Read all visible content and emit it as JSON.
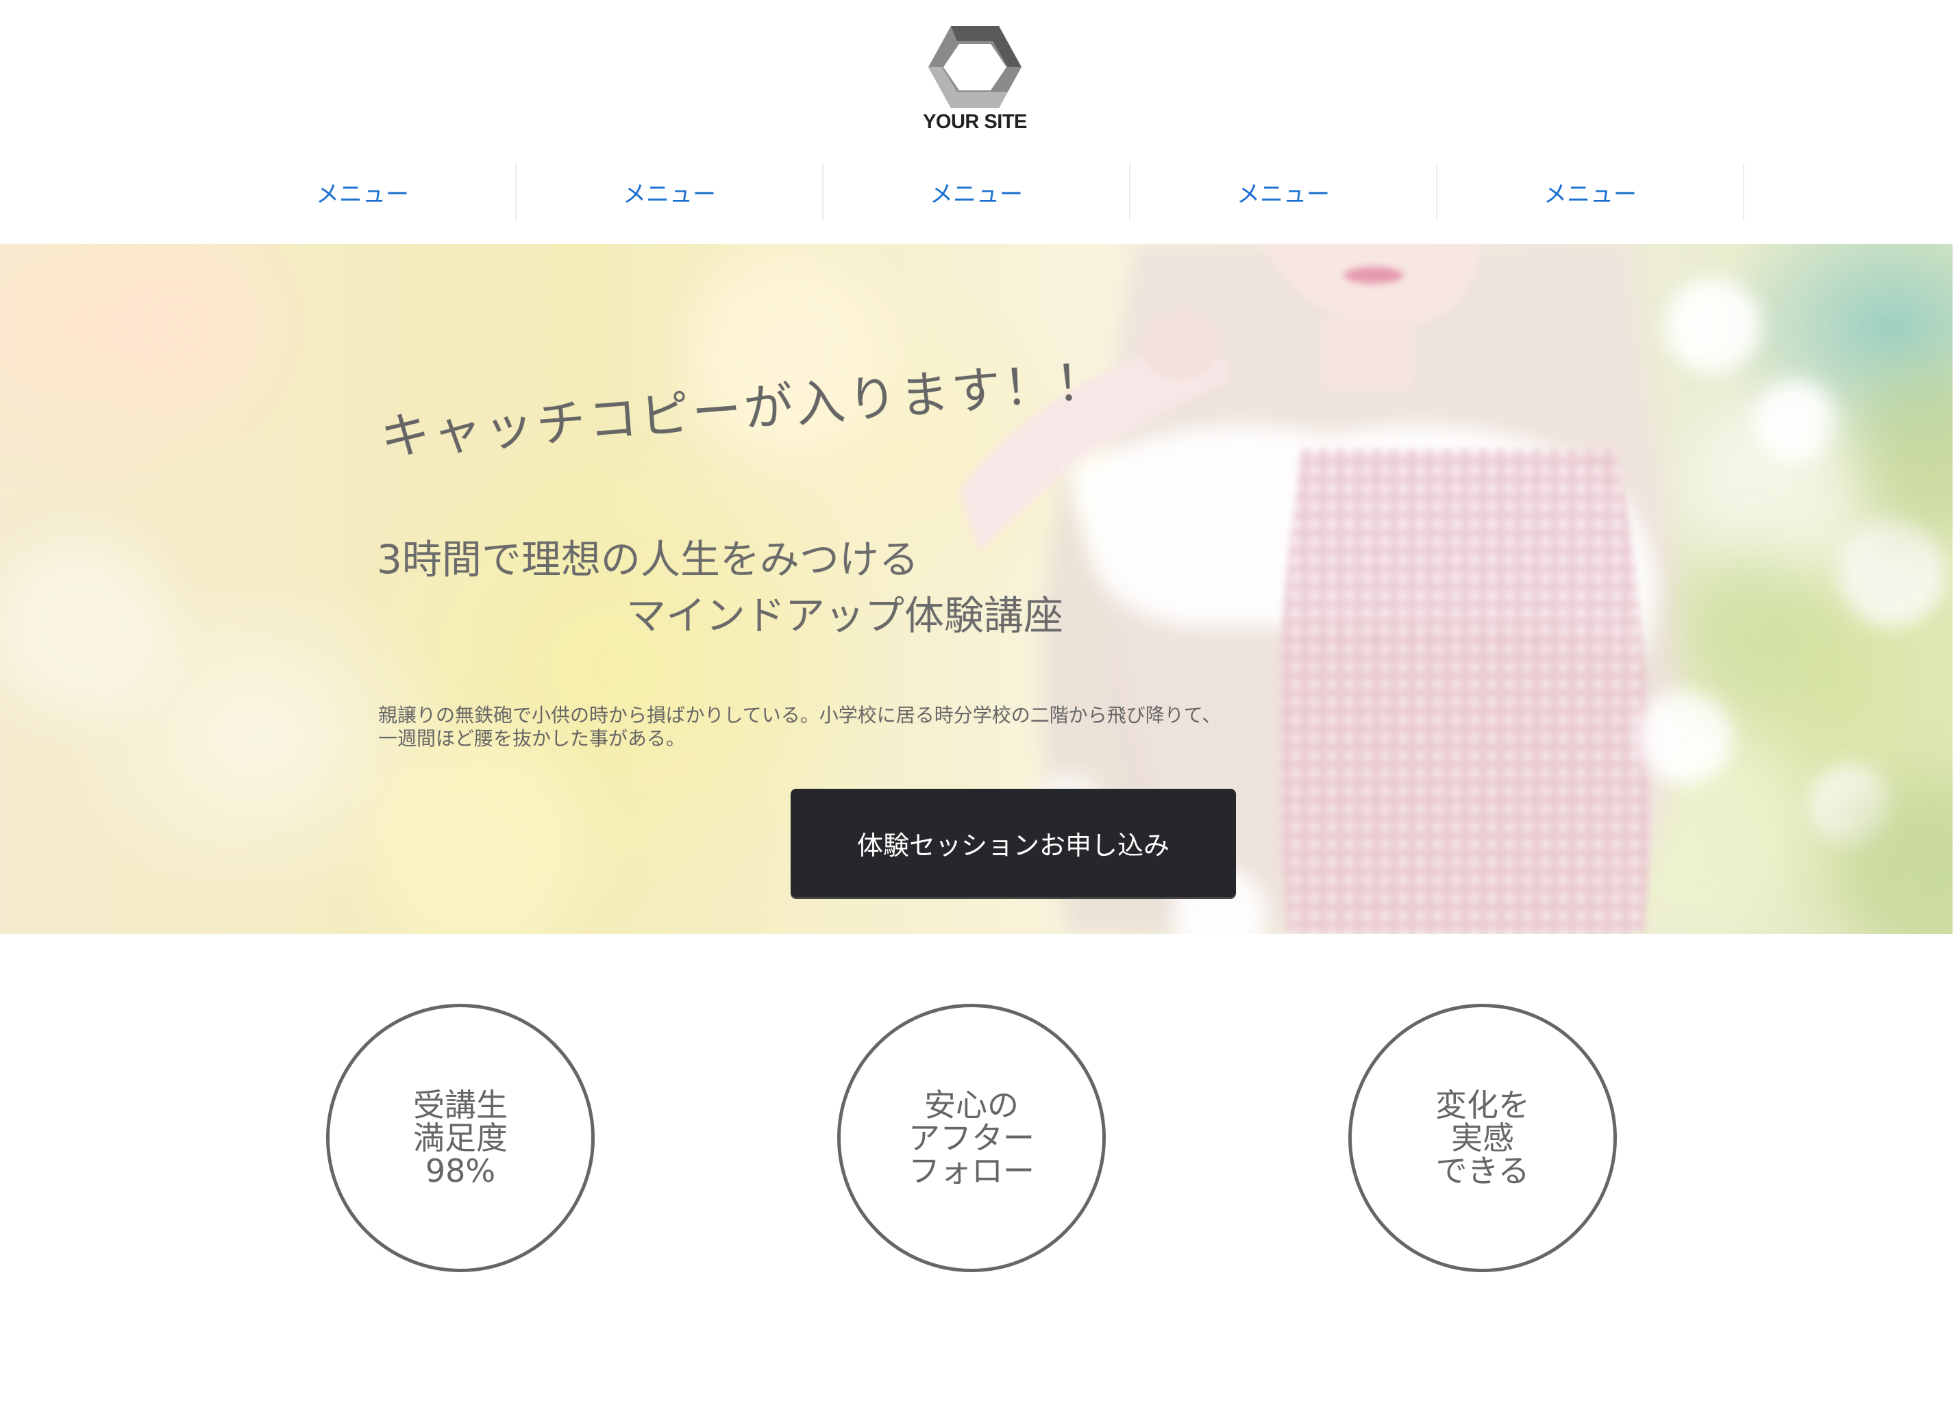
{
  "header": {
    "logo_text": "YOUR SITE",
    "logo_icon": "hexagon-logo-icon"
  },
  "nav": {
    "items": [
      {
        "label": "メニュー"
      },
      {
        "label": "メニュー"
      },
      {
        "label": "メニュー"
      },
      {
        "label": "メニュー"
      },
      {
        "label": "メニュー"
      }
    ]
  },
  "hero": {
    "catchcopy": "キャッチコピーが入ります！！",
    "headline_line1": "3時間で理想の人生をみつける",
    "headline_line2": "マインドアップ体験講座",
    "body_line1": "親譲りの無鉄砲で小供の時から損ばかりしている。小学校に居る時分学校の二階から飛び降りて、",
    "body_line2": "一週間ほど腰を抜かした事がある。",
    "cta_label": "体験セッションお申し込み"
  },
  "features": [
    {
      "line1": "受講生",
      "line2": "満足度",
      "line3": "98%"
    },
    {
      "line1": "安心の",
      "line2": "アフター",
      "line3": "フォロー"
    },
    {
      "line1": "変化を",
      "line2": "実感",
      "line3": "できる"
    }
  ],
  "colors": {
    "nav_link": "#1a6fd0",
    "text_gray": "#666666",
    "button_bg": "#25272b",
    "button_text": "#ffffff",
    "circle_border": "#666666"
  }
}
